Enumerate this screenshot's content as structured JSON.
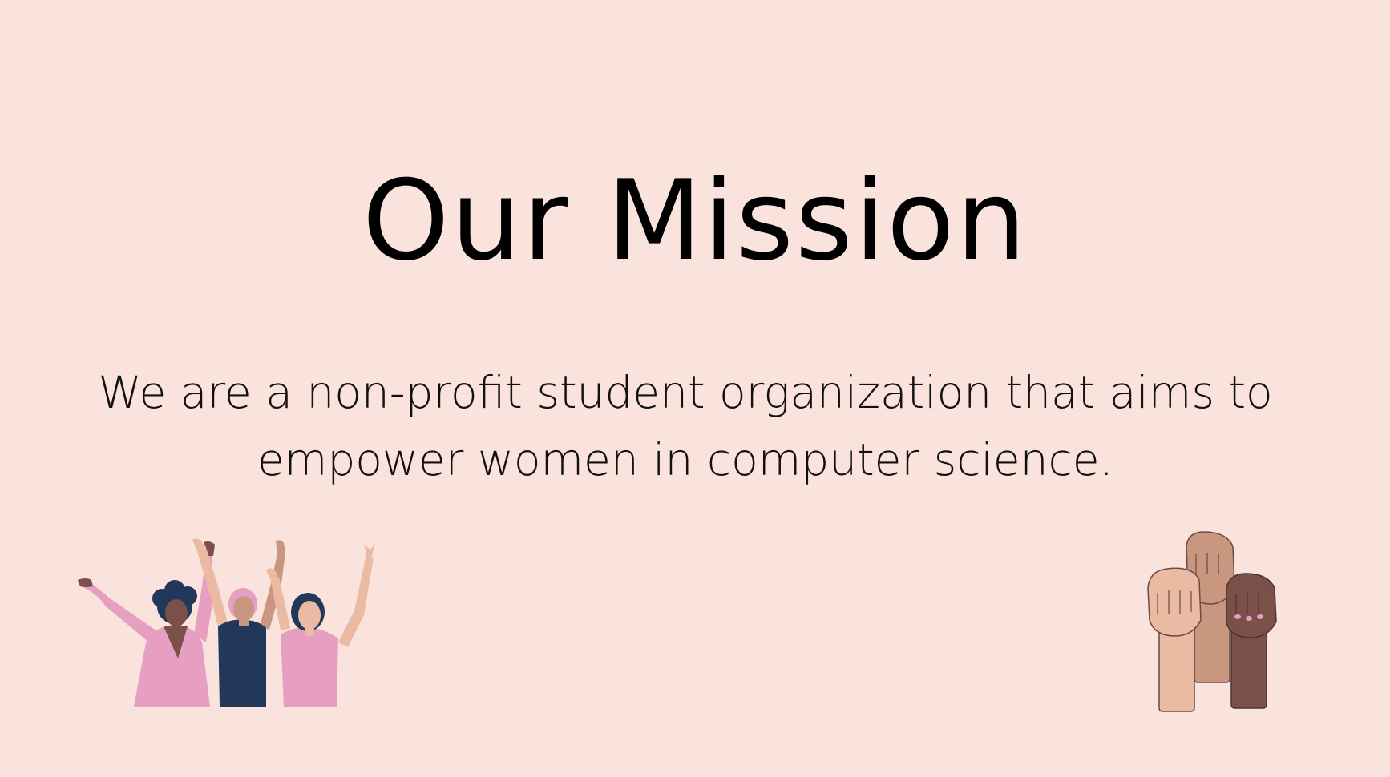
{
  "slide": {
    "title": "Our Mission",
    "body_line1": "We are a non-profit student organization that aims to",
    "body_line2": "empower women in computer science."
  },
  "colors": {
    "background": "#f9e3dc",
    "text": "#000000",
    "pink": "#e69fc0",
    "navy": "#22385a",
    "skin_light": "#ebbaa3",
    "skin_medium": "#c9967f",
    "skin_dark": "#7a5048"
  },
  "illustrations": {
    "left": "celebrating-women-illustration",
    "right": "raised-fists-illustration"
  }
}
